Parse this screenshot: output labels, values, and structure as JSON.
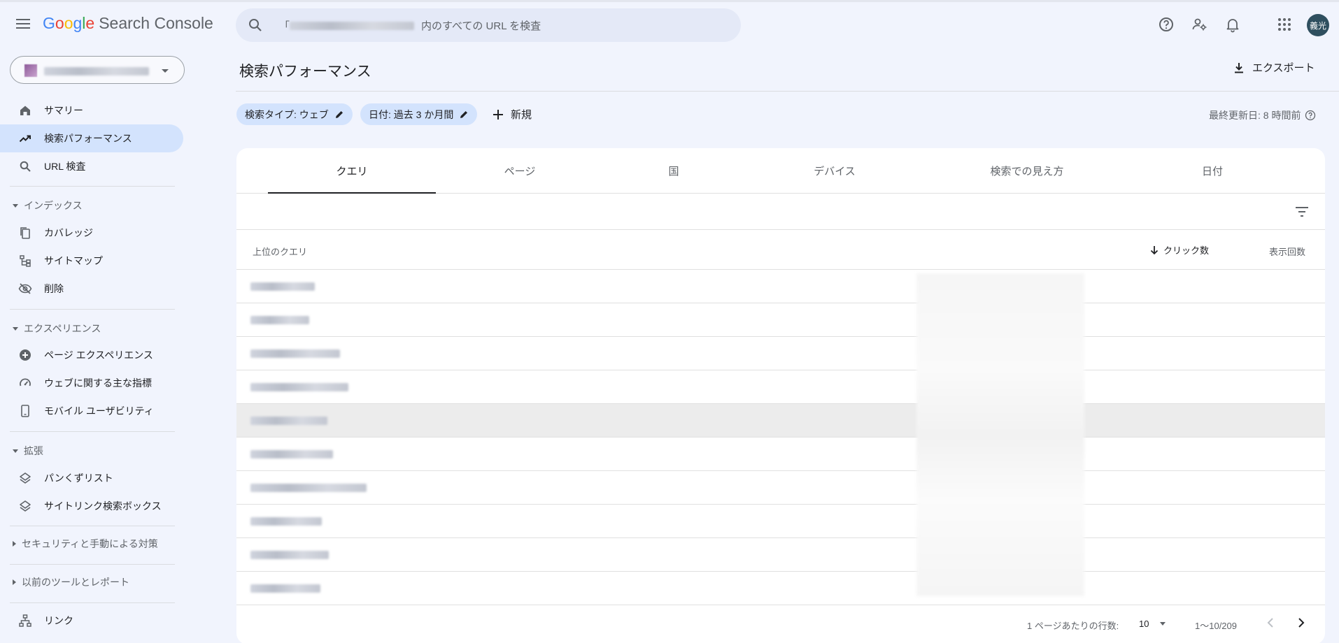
{
  "app": {
    "logo_letters": [
      "G",
      "o",
      "o",
      "g",
      "l",
      "e"
    ],
    "product": "Search Console",
    "search_prefix": "「",
    "search_placeholder": "内のすべての URL を検査",
    "avatar_text": "義光"
  },
  "sidebar": {
    "items": [
      {
        "label": "サマリー",
        "icon": "home-icon"
      },
      {
        "label": "検索パフォーマンス",
        "icon": "trending-up-icon",
        "active": true
      },
      {
        "label": "URL 検査",
        "icon": "search-icon"
      }
    ],
    "sections": [
      {
        "label": "インデックス",
        "items": [
          {
            "label": "カバレッジ",
            "icon": "file-copy-icon"
          },
          {
            "label": "サイトマップ",
            "icon": "sitemap-icon"
          },
          {
            "label": "削除",
            "icon": "visibility-off-icon"
          }
        ]
      },
      {
        "label": "エクスペリエンス",
        "items": [
          {
            "label": "ページ エクスペリエンス",
            "icon": "add-circle-icon"
          },
          {
            "label": "ウェブに関する主な指標",
            "icon": "speed-icon"
          },
          {
            "label": "モバイル ユーザビリティ",
            "icon": "smartphone-icon"
          }
        ]
      },
      {
        "label": "拡張",
        "items": [
          {
            "label": "パンくずリスト",
            "icon": "layers-icon"
          },
          {
            "label": "サイトリンク検索ボックス",
            "icon": "layers-icon"
          }
        ]
      }
    ],
    "collapsed": [
      {
        "label": "セキュリティと手動による対策"
      },
      {
        "label": "以前のツールとレポート"
      }
    ],
    "links_label": "リンク"
  },
  "main": {
    "title": "検索パフォーマンス",
    "export_label": "エクスポート",
    "chips": [
      "検索タイプ: ウェブ",
      "日付: 過去 3 か月間"
    ],
    "new_label": "新規",
    "updated_label": "最終更新日: 8 時間前",
    "tabs": [
      "クエリ",
      "ページ",
      "国",
      "デバイス",
      "検索での見え方",
      "日付"
    ],
    "active_tab": "クエリ",
    "table": {
      "col_query": "上位のクエリ",
      "col_clicks": "クリック数",
      "col_impressions": "表示回数",
      "row_count_visible": 10
    },
    "pager": {
      "rows_per_page_label": "1 ページあたりの行数:",
      "rows_per_page": "10",
      "range": "1〜10/209"
    }
  },
  "colors": {
    "background": "#f1f4fd",
    "active_nav": "#d3e3fd",
    "chip": "#d3e3fd",
    "search_bg": "#e4e9f7"
  }
}
